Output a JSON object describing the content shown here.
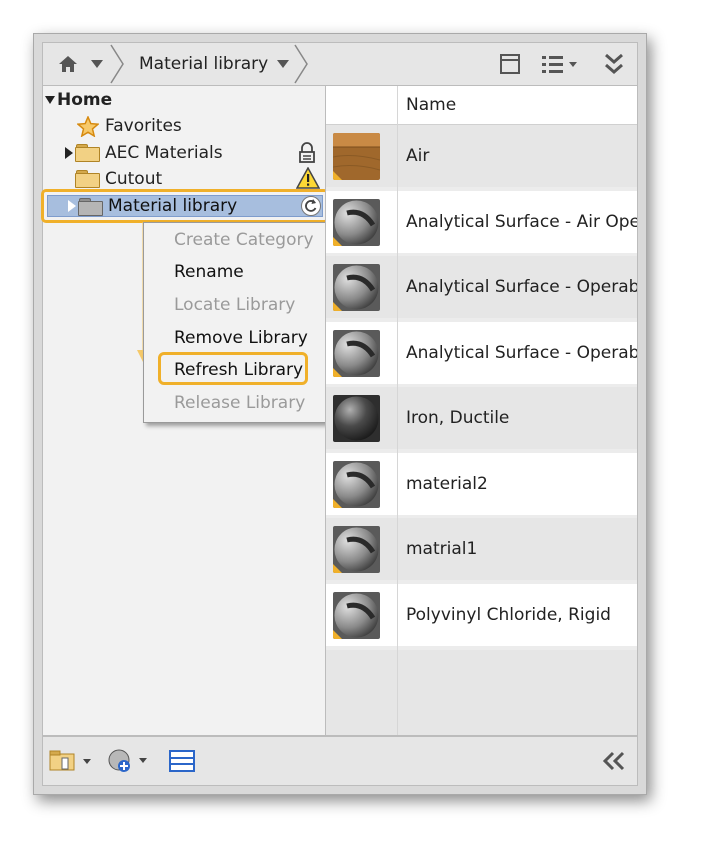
{
  "toolbar": {
    "home_icon": "home-icon",
    "breadcrumb_label": "Material library",
    "view_icon": "view-toggle-icon",
    "list_icon": "list-options-icon",
    "collapse_icon": "double-chevron-down-icon"
  },
  "tree": {
    "root_label": "Home",
    "items": [
      {
        "label": "Favorites",
        "icon": "star-icon"
      },
      {
        "label": "AEC Materials",
        "icon": "folder-icon",
        "badge": "lock-icon"
      },
      {
        "label": "Cutout",
        "icon": "folder-icon",
        "badge": "warning-icon"
      },
      {
        "label": "Material library",
        "icon": "folder-icon",
        "badge": "refresh-icon"
      }
    ]
  },
  "context_menu": {
    "items": [
      {
        "label": "Create Category",
        "enabled": false
      },
      {
        "label": "Rename",
        "enabled": true
      },
      {
        "label": "Locate Library",
        "enabled": false
      },
      {
        "label": "Remove Library",
        "enabled": true
      },
      {
        "label": "Refresh Library",
        "enabled": true,
        "highlighted": true
      },
      {
        "label": "Release Library",
        "enabled": false
      }
    ]
  },
  "list": {
    "column_header": "Name",
    "rows": [
      {
        "name": "Air",
        "thumb": "wood-cube"
      },
      {
        "name": "Analytical Surface - Air Oper",
        "thumb": "sphere"
      },
      {
        "name": "Analytical Surface - Operabl",
        "thumb": "sphere"
      },
      {
        "name": "Analytical Surface - Operabl",
        "thumb": "sphere"
      },
      {
        "name": "Iron, Ductile",
        "thumb": "dark-sphere"
      },
      {
        "name": "material2",
        "thumb": "sphere"
      },
      {
        "name": "matrial1",
        "thumb": "sphere"
      },
      {
        "name": "Polyvinyl Chloride, Rigid",
        "thumb": "sphere"
      }
    ]
  },
  "bottom_bar": {
    "icons": [
      "library-manage-icon",
      "add-material-icon",
      "panel-icon",
      "collapse-left-icon"
    ]
  },
  "colors": {
    "highlight": "#f0b02a",
    "selection": "#a7bede"
  }
}
